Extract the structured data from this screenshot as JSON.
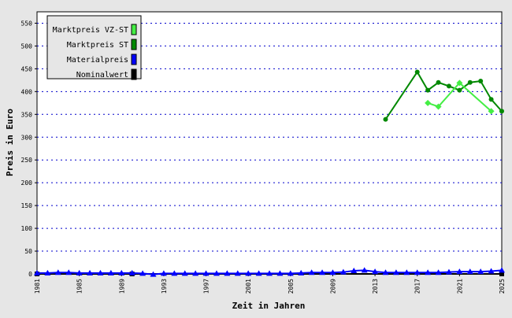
{
  "chart_data": {
    "type": "line",
    "xlabel": "Zeit in Jahren",
    "ylabel": "Preis in Euro",
    "xlim": [
      1981,
      2025
    ],
    "ylim": [
      0,
      575
    ],
    "x_ticks": [
      1981,
      1985,
      1989,
      1993,
      1997,
      2001,
      2005,
      2009,
      2013,
      2017,
      2021,
      2025
    ],
    "y_ticks": [
      0,
      50,
      100,
      150,
      200,
      250,
      300,
      350,
      400,
      450,
      500,
      550
    ],
    "grid": "horizontal-dotted",
    "legend_position": "top-left",
    "series": [
      {
        "name": "Marktpreis VZ-ST",
        "color": "#44ee44",
        "marker": "diamond",
        "points": [
          [
            2018,
            375
          ],
          [
            2019,
            367
          ],
          [
            2021,
            419
          ],
          [
            2024,
            357
          ]
        ]
      },
      {
        "name": "Marktpreis ST",
        "color": "#008800",
        "marker": "circle",
        "points": [
          [
            2014,
            339
          ],
          [
            2017,
            443
          ],
          [
            2018,
            403
          ],
          [
            2019,
            420
          ],
          [
            2020,
            412
          ],
          [
            2021,
            403
          ],
          [
            2022,
            420
          ],
          [
            2023,
            423
          ],
          [
            2024,
            383
          ],
          [
            2025,
            357
          ]
        ]
      },
      {
        "name": "Materialpreis",
        "color": "#0000ff",
        "marker": "triangle",
        "points": [
          [
            1981,
            2
          ],
          [
            1982,
            2
          ],
          [
            1983,
            3
          ],
          [
            1984,
            3
          ],
          [
            1985,
            2
          ],
          [
            1986,
            2
          ],
          [
            1987,
            2
          ],
          [
            1988,
            2
          ],
          [
            1989,
            2
          ],
          [
            1990,
            2
          ],
          [
            1991,
            1
          ],
          [
            1992,
            -1
          ],
          [
            1993,
            1
          ],
          [
            1994,
            1
          ],
          [
            1995,
            1
          ],
          [
            1996,
            1
          ],
          [
            1997,
            1
          ],
          [
            1998,
            1
          ],
          [
            1999,
            1
          ],
          [
            2000,
            1
          ],
          [
            2001,
            1
          ],
          [
            2002,
            1
          ],
          [
            2003,
            1
          ],
          [
            2004,
            1
          ],
          [
            2005,
            1
          ],
          [
            2006,
            2
          ],
          [
            2007,
            3
          ],
          [
            2008,
            3
          ],
          [
            2009,
            3
          ],
          [
            2010,
            4
          ],
          [
            2011,
            7
          ],
          [
            2012,
            8
          ],
          [
            2013,
            5
          ],
          [
            2014,
            3
          ],
          [
            2015,
            3
          ],
          [
            2016,
            3
          ],
          [
            2017,
            3
          ],
          [
            2018,
            3
          ],
          [
            2019,
            3
          ],
          [
            2020,
            4
          ],
          [
            2021,
            5
          ],
          [
            2022,
            5
          ],
          [
            2023,
            5
          ],
          [
            2024,
            6
          ],
          [
            2025,
            8
          ]
        ]
      },
      {
        "name": "Nominalwert",
        "color": "#000000",
        "marker": "square",
        "points": [
          [
            1981,
            0
          ],
          [
            1990,
            0
          ],
          [
            2025,
            0
          ]
        ]
      }
    ]
  }
}
